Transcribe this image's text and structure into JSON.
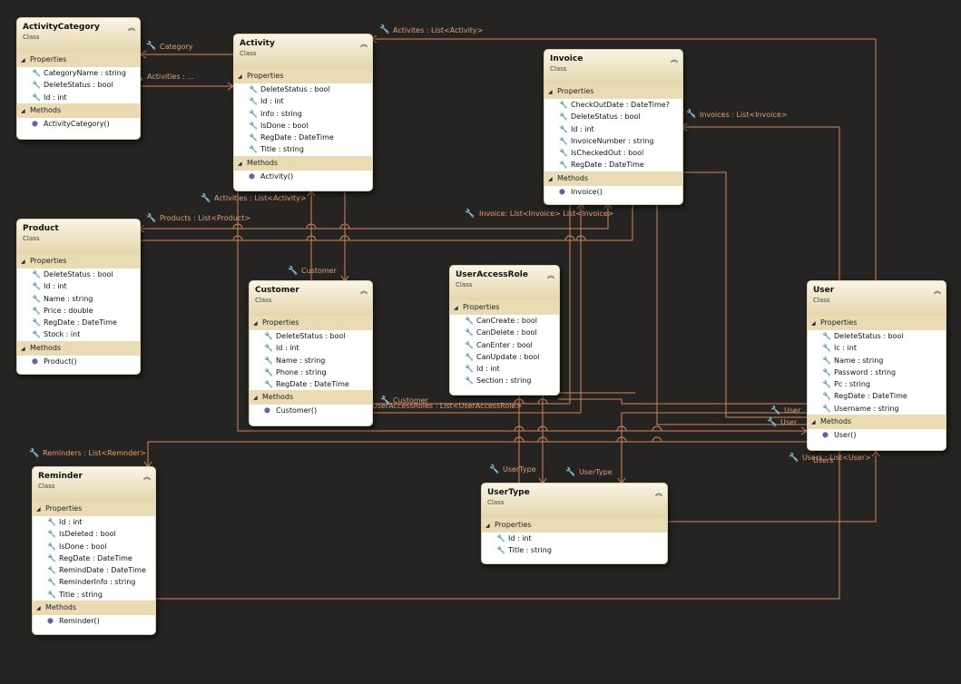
{
  "colors": {
    "background": "#252423",
    "connector": "#d9845a",
    "label": "#e0a078",
    "header": "#e9dcb4"
  },
  "section_labels": {
    "properties": "Properties",
    "methods": "Methods"
  },
  "icons": {
    "property": "wrench-icon",
    "method": "cube-icon",
    "collapse": "chevron-up-icon"
  },
  "classes": {
    "activitycategory": {
      "name": "ActivityCategory",
      "kind": "Class",
      "properties": [
        "CategoryName : string",
        "DeleteStatus : bool",
        "Id : int"
      ],
      "methods": [
        "ActivityCategory()"
      ]
    },
    "activity": {
      "name": "Activity",
      "kind": "Class",
      "properties": [
        "DeleteStatus : bool",
        "Id : int",
        "Info : string",
        "IsDone : bool",
        "RegDate : DateTime",
        "Title : string"
      ],
      "methods": [
        "Activity()"
      ]
    },
    "invoice": {
      "name": "Invoice",
      "kind": "Class",
      "properties": [
        "CheckOutDate : DateTime?",
        "DeleteStatus : bool",
        "Id : int",
        "InvoiceNumber : string",
        "IsCheckedOut : bool",
        "RegDate : DateTime"
      ],
      "methods": [
        "Invoice()"
      ]
    },
    "product": {
      "name": "Product",
      "kind": "Class",
      "properties": [
        "DeleteStatus : bool",
        "Id : int",
        "Name : string",
        "Price : double",
        "RegDate : DateTime",
        "Stock : int"
      ],
      "methods": [
        "Product()"
      ]
    },
    "customer": {
      "name": "Customer",
      "kind": "Class",
      "properties": [
        "DeleteStatus : bool",
        "Id : int",
        "Name : string",
        "Phone : string",
        "RegDate : DateTime"
      ],
      "methods": [
        "Customer()"
      ]
    },
    "useraccessrole": {
      "name": "UserAccessRole",
      "kind": "Class",
      "properties": [
        "CanCreate : bool",
        "CanDelete : bool",
        "CanEnter : bool",
        "CanUpdate : bool",
        "Id : int",
        "Section : string"
      ],
      "methods": []
    },
    "user": {
      "name": "User",
      "kind": "Class",
      "properties": [
        "DeleteStatus : bool",
        "Ic : int",
        "Name : string",
        "Password : string",
        "Pc : string",
        "RegDate : DateTime",
        "Username : string"
      ],
      "methods": [
        "User()"
      ]
    },
    "reminder": {
      "name": "Reminder",
      "kind": "Class",
      "properties": [
        "Id : int",
        "IsDeleted : bool",
        "IsDone : bool",
        "RegDate : DateTime",
        "RemindDate : DateTime",
        "ReminderInfo : string",
        "Title : string"
      ],
      "methods": [
        "Reminder()"
      ]
    },
    "usertype": {
      "name": "UserType",
      "kind": "Class",
      "properties": [
        "Id : int",
        "Title : string"
      ],
      "methods": []
    }
  },
  "associations": {
    "category": "Category",
    "activities_short": "Activities : ...",
    "activites": "Activites : List<Activity>",
    "activities_list": "Activities : List<Activity>",
    "products": "Products : List<Product>",
    "invoices_user": "Invoices : List<Invoice>",
    "invoices_overlap": "Invoice: List<Invoice> List<Invoice>",
    "customer": "Customer",
    "customer2": "Customer",
    "useraccessroles": "UserAccessRoles : List<UserAccessRole>",
    "reminders": "Reminders : List<Remnder>",
    "usertype1": "UserType",
    "usertype2": "UserType",
    "user1": "User",
    "user2": "User",
    "users": "Users : List<User>",
    "users2": "Users"
  }
}
